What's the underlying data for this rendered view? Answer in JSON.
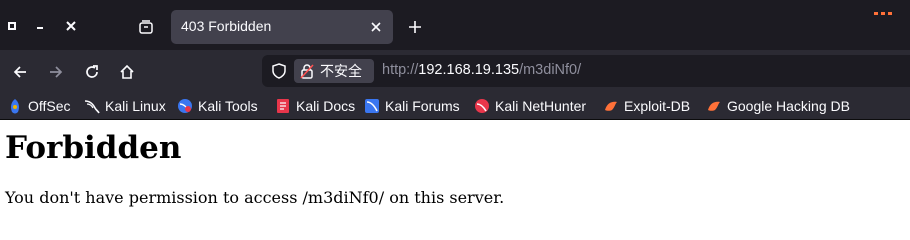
{
  "browser": {
    "active_tab": {
      "title": "403 Forbidden"
    },
    "security": {
      "label": "不安全"
    },
    "url": {
      "scheme": "http://",
      "host": "192.168.19.135",
      "path": "/m3diNf0/"
    },
    "bookmarks": [
      {
        "label": "OffSec",
        "icon": "offsec-icon"
      },
      {
        "label": "Kali Linux",
        "icon": "kali-linux-icon"
      },
      {
        "label": "Kali Tools",
        "icon": "kali-tools-icon"
      },
      {
        "label": "Kali Docs",
        "icon": "kali-docs-icon"
      },
      {
        "label": "Kali Forums",
        "icon": "kali-forums-icon"
      },
      {
        "label": "Kali NetHunter",
        "icon": "kali-nethunter-icon"
      },
      {
        "label": "Exploit-DB",
        "icon": "exploit-db-icon"
      },
      {
        "label": "Google Hacking DB",
        "icon": "google-hacking-db-icon"
      }
    ]
  },
  "page": {
    "heading": "Forbidden",
    "message": "You don't have permission to access /m3diNf0/ on this server."
  },
  "colors": {
    "tabbar_bg": "#1c1b22",
    "toolbar_bg": "#2b2a33",
    "active_tab_bg": "#42414d",
    "text_light": "#fbfbfe",
    "text_dim": "#8f8f9d",
    "accent": "#ff7139"
  }
}
